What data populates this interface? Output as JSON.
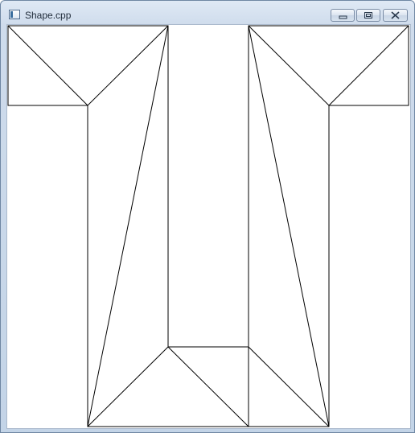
{
  "window": {
    "title": "Shape.cpp",
    "icon": "app-window-icon",
    "controls": {
      "minimize_icon": "minimize-icon",
      "maximize_icon": "maximize-icon",
      "close_icon": "close-icon"
    }
  },
  "canvas": {
    "background": "#ffffff",
    "stroke": "#000000",
    "shape": "wireframe-U-shape"
  }
}
